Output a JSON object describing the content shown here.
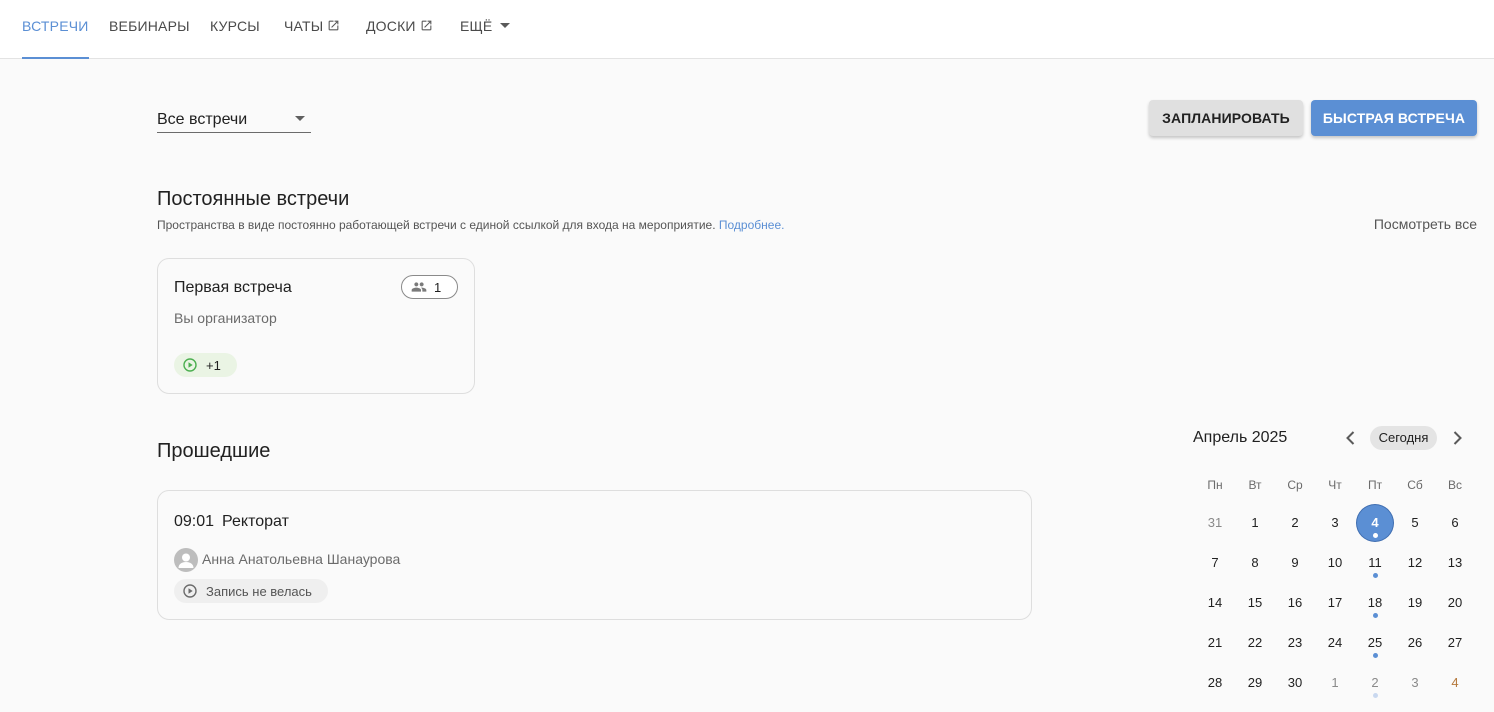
{
  "nav": {
    "tabs": [
      {
        "label": "ВСТРЕЧИ"
      },
      {
        "label": "ВЕБИНАРЫ"
      },
      {
        "label": "КУРСЫ"
      },
      {
        "label": "ЧАТЫ"
      },
      {
        "label": "ДОСКИ"
      },
      {
        "label": "ЕЩЁ"
      }
    ]
  },
  "filter": {
    "selected": "Все встречи"
  },
  "actions": {
    "schedule_label": "ЗАПЛАНИРОВАТЬ",
    "quick_label": "БЫСТРАЯ ВСТРЕЧА"
  },
  "permanent": {
    "title": "Постоянные встречи",
    "description": "Пространства в виде постоянно работающей встречи с единой ссылкой для входа на мероприятие.",
    "more_link": "Подробнее.",
    "view_all": "Посмотреть все",
    "card": {
      "title": "Первая встреча",
      "participants": "1",
      "role": "Вы организатор",
      "recordings": "+1"
    }
  },
  "past": {
    "title": "Прошедшие",
    "card": {
      "time": "09:01",
      "title": "Ректорат",
      "author": "Анна Анатольевна Шанаурова",
      "recording_status": "Запись не велась"
    }
  },
  "calendar": {
    "month_label": "Апрель 2025",
    "today_label": "Сегодня",
    "weekdays": [
      "Пн",
      "Вт",
      "Ср",
      "Чт",
      "Пт",
      "Сб",
      "Вс"
    ],
    "days": [
      "31",
      "1",
      "2",
      "3",
      "4",
      "5",
      "6",
      "7",
      "8",
      "9",
      "10",
      "11",
      "12",
      "13",
      "14",
      "15",
      "16",
      "17",
      "18",
      "19",
      "20",
      "21",
      "22",
      "23",
      "24",
      "25",
      "26",
      "27",
      "28",
      "29",
      "30",
      "1",
      "2",
      "3",
      "4"
    ],
    "selected_day": "4",
    "colors": {
      "accent": "#5b8fd4",
      "weekend_next": "#b5793c"
    }
  },
  "icons": [
    "external-link-icon",
    "chevron-down-icon",
    "people-icon",
    "play-circle-icon",
    "person-icon",
    "chevron-left-icon",
    "chevron-right-icon"
  ]
}
